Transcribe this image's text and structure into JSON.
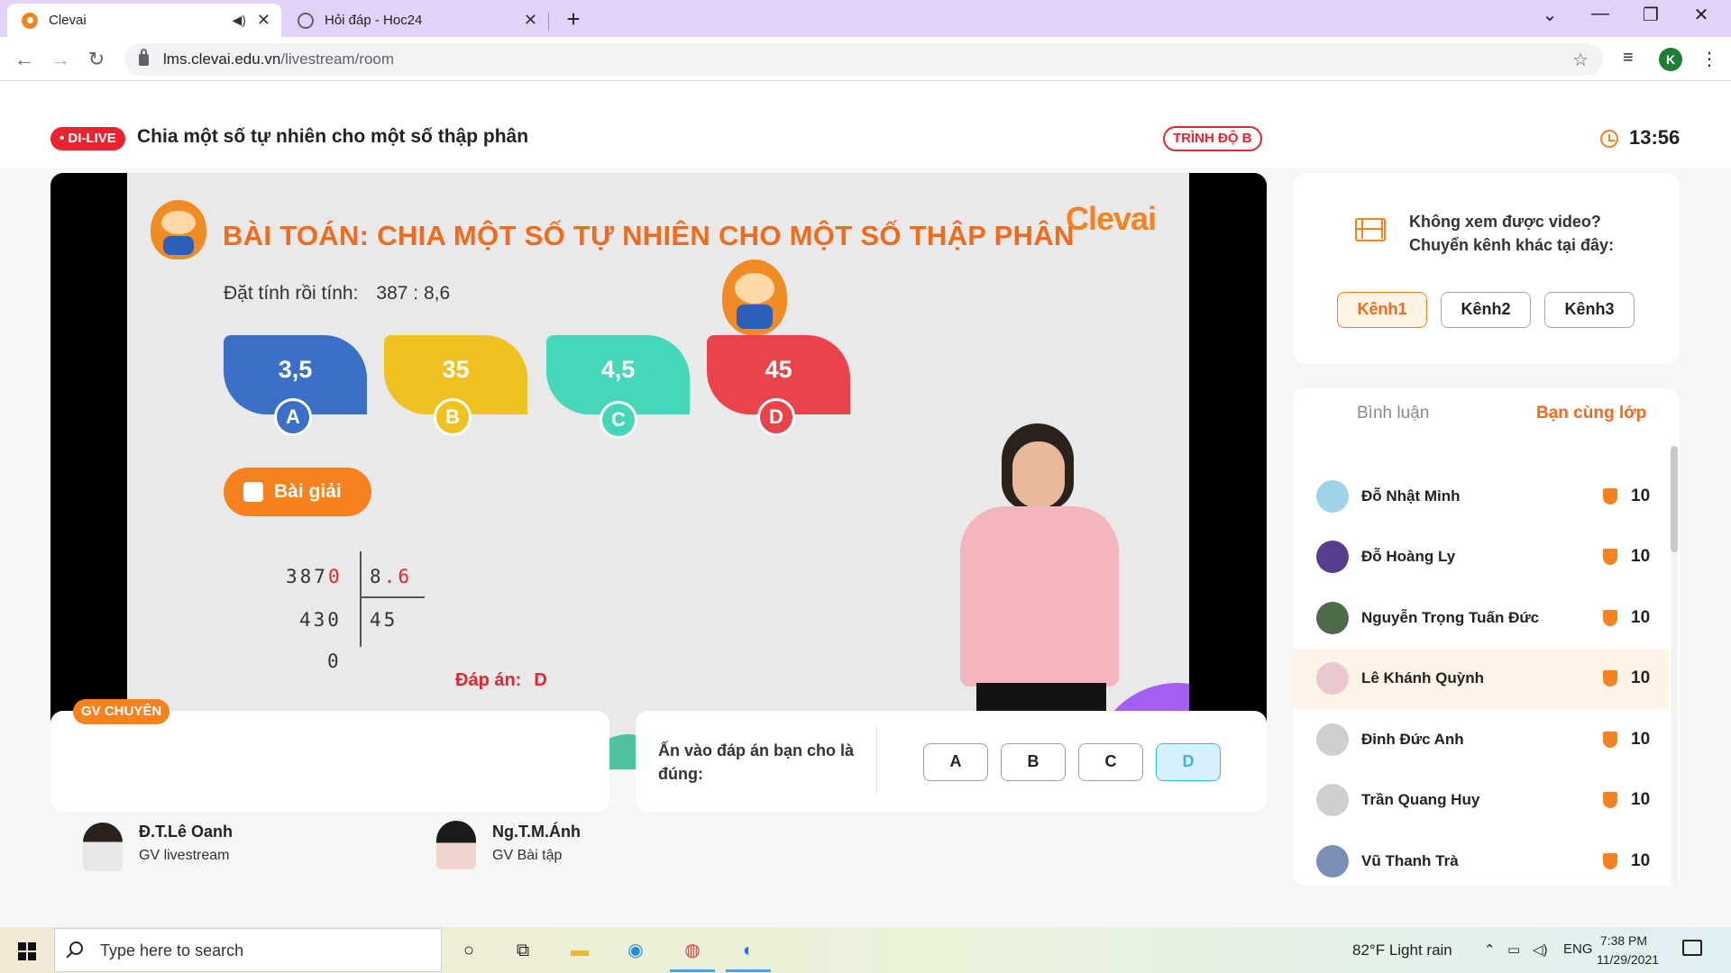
{
  "browser": {
    "tabs": [
      {
        "title": "Clevai",
        "active": true
      },
      {
        "title": "Hỏi đáp - Hoc24",
        "active": false
      }
    ],
    "new_tab_label": "+",
    "url_host": "lms.clevai.edu.vn",
    "url_path": "/livestream/room",
    "profile_initial": "K"
  },
  "header": {
    "live_badge": "• DI-LIVE",
    "lesson_title": "Chia một số tự nhiên cho một số thập phân",
    "level_badge": "TRÌNH ĐỘ B",
    "clock_time": "13:56"
  },
  "slide": {
    "title": "BÀI TOÁN: CHIA MỘT SỐ TỰ NHIÊN CHO MỘT SỐ THẬP PHÂN",
    "brand": "Clevai",
    "problem_label": "Đặt tính rồi tính:",
    "problem_expr": "387 : 8,6",
    "options": [
      {
        "letter": "A",
        "value": "3,5",
        "color": "#3c6fc6"
      },
      {
        "letter": "B",
        "value": "35",
        "color": "#efc222"
      },
      {
        "letter": "C",
        "value": "4,5",
        "color": "#46d7b8"
      },
      {
        "letter": "D",
        "value": "45",
        "color": "#e9434b"
      }
    ],
    "solution_button": "Bài giải",
    "calc": {
      "dividend_main": "387",
      "dividend_zero": "0",
      "divisor_int": "8",
      "divisor_dot": ".",
      "divisor_dec": "6",
      "remainder1": "430",
      "quotient": "45",
      "remainder2": "0"
    },
    "answer_label": "Đáp án:",
    "answer_value": "D"
  },
  "teachers": {
    "badge": "GV CHUYÊN",
    "list": [
      {
        "name": "Đ.T.Lê Oanh",
        "role": "GV livestream"
      },
      {
        "name": "Ng.T.M.Ánh",
        "role": "GV Bài tập"
      }
    ]
  },
  "answer_panel": {
    "prompt": "Ấn vào đáp án bạn cho là đúng:",
    "buttons": [
      "A",
      "B",
      "C",
      "D"
    ],
    "selected": "D"
  },
  "channel_panel": {
    "line1": "Không xem được video?",
    "line2": "Chuyển kênh khác tại đây:",
    "channels": [
      "Kênh1",
      "Kênh2",
      "Kênh3"
    ],
    "active_channel": "Kênh1"
  },
  "class_panel": {
    "tabs": [
      "Bình luận",
      "Bạn cùng lớp"
    ],
    "active_tab": "Bạn cùng lớp",
    "students": [
      {
        "name": "Đỗ Nhật Minh",
        "points": "10",
        "avatar_color": "#9fd3e8"
      },
      {
        "name": "Đỗ Hoàng Ly",
        "points": "10",
        "avatar_color": "#5a3c8c"
      },
      {
        "name": "Nguyễn Trọng Tuấn Đức",
        "points": "10",
        "avatar_color": "#4e6a4b"
      },
      {
        "name": "Lê Khánh Quỳnh",
        "points": "10",
        "avatar_color": "#e9c9cf"
      },
      {
        "name": "Đinh Đức Anh",
        "points": "10",
        "avatar_color": "#cfcfcf"
      },
      {
        "name": "Trần Quang Huy",
        "points": "10",
        "avatar_color": "#cfcfcf"
      },
      {
        "name": "Vũ Thanh Trà",
        "points": "10",
        "avatar_color": "#7a8fb8"
      }
    ],
    "highlight_index": 3
  },
  "taskbar": {
    "search_placeholder": "Type here to search",
    "weather": "82°F  Light rain",
    "language": "ENG",
    "time": "7:38 PM",
    "date": "11/29/2021"
  }
}
